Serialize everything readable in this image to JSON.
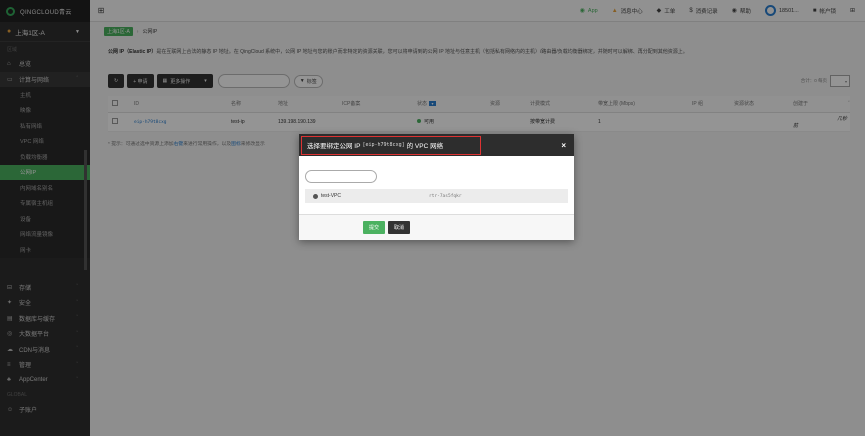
{
  "sidebar": {
    "brand": "QINGCLOUD青云",
    "zone": "上海1区-A",
    "section_main": "区域",
    "section_global": "GLOBAL",
    "top_items": [
      {
        "icon": "home-icon",
        "label": "总览"
      }
    ],
    "compute_group": {
      "icon": "monitor-icon",
      "label": "计算与网络"
    },
    "sub_items": [
      {
        "label": "主机",
        "active": false
      },
      {
        "label": "映像",
        "active": false
      },
      {
        "label": "私有网络",
        "active": false
      },
      {
        "label": "VPC 网络",
        "active": false
      },
      {
        "label": "负载均衡器",
        "active": false
      },
      {
        "label": "公网IP",
        "active": true
      },
      {
        "label": "内网域名别名",
        "active": false
      },
      {
        "label": "专属宿主机组",
        "active": false
      },
      {
        "label": "设备",
        "active": false
      },
      {
        "label": "网络流量镜像",
        "active": false
      },
      {
        "label": "网卡",
        "active": false
      }
    ],
    "groups": [
      {
        "icon": "storage-icon",
        "label": "存储"
      },
      {
        "icon": "security-icon",
        "label": "安全"
      },
      {
        "icon": "database-icon",
        "label": "数据库与缓存"
      },
      {
        "icon": "bigdata-icon",
        "label": "大数据平台"
      },
      {
        "icon": "cdn-icon",
        "label": "CDN与消息"
      },
      {
        "icon": "management-icon",
        "label": "管理"
      },
      {
        "icon": "appcenter-icon",
        "label": "AppCenter"
      }
    ],
    "global_items": [
      {
        "icon": "user-icon",
        "label": "子账户"
      }
    ]
  },
  "topbar": {
    "items": [
      {
        "icon": "app-icon",
        "label": "App"
      },
      {
        "icon": "bell-icon",
        "label": "消息中心"
      },
      {
        "icon": "ticket-icon",
        "label": "工单"
      },
      {
        "icon": "dollar-icon",
        "label": "消费记录"
      },
      {
        "icon": "help-icon",
        "label": "帮助"
      },
      {
        "icon": "avatar-icon",
        "label": "18501..."
      },
      {
        "icon": "lock-icon",
        "label": "帐户锁"
      }
    ]
  },
  "breadcrumb": {
    "zone": "上海1区-A",
    "page": "公网IP"
  },
  "description": {
    "bold": "公网 IP（Elastic IP）",
    "text": "是在互联网上合法的静态 IP 地址。在 QingCloud 系统中，公网 IP 地址与您的账户而非特定的资源关联，您可以将申请到的公网 IP 地址与任意主机（包括私有网络内的主机）/路由器/负载均衡器绑定，并随时可以解绑、再分配到其他资源上。"
  },
  "toolbar": {
    "refresh": "↻",
    "apply": "+ 申请",
    "more": "更多操作",
    "search_placeholder": "",
    "tag": "标签",
    "total": "合计：0 每页",
    "per_page": ""
  },
  "table": {
    "columns": [
      "",
      "ID",
      "名称",
      "地址",
      "ICP备案",
      "状态",
      "资源",
      "计费模式",
      "带宽上限 (Mbps)",
      "IP 组",
      "资源状态",
      "创建于"
    ],
    "rows": [
      [
        "",
        "eip-h79t8cxg",
        "test-ip",
        "139.198.190.139",
        "",
        "可用",
        "",
        "按带宽计费",
        "1",
        "",
        "",
        "几秒前"
      ]
    ]
  },
  "hint": {
    "prefix": "* 提示：可通过选中资源上添加",
    "link1": "右键",
    "middle": "来进行常用操作，以及",
    "link2": "图标",
    "suffix": "来修改显示"
  },
  "dialog": {
    "title_prefix": "选择要绑定公网 IP",
    "title_id": "[eip-h79t8cxg]",
    "title_suffix": "的 VPC 网络",
    "search_placeholder": "",
    "vpc": {
      "name": "test-VPC",
      "id": "rtr-7as5fqkr"
    },
    "ok": "提交",
    "cancel": "取消"
  },
  "colors": {
    "accent": "#4bb160",
    "sidebar": "#303030",
    "link": "#2a7fd0",
    "highlight_box": "#dd3333"
  }
}
